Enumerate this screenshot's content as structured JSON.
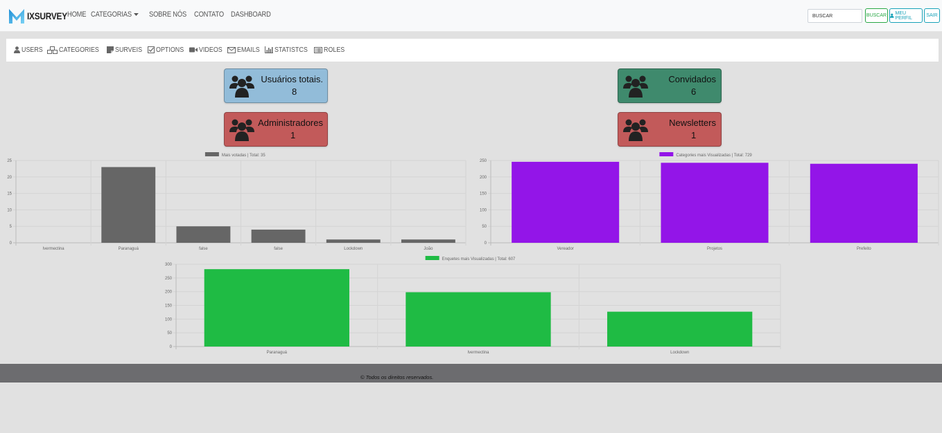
{
  "navbar": {
    "brand": "IXSURVEY",
    "links": [
      {
        "label": "HOME"
      },
      {
        "label": "CATEGORIAS"
      },
      {
        "label": "SOBRE NÓS"
      },
      {
        "label": "CONTATO"
      },
      {
        "label": "DASHBOARD"
      }
    ],
    "search_placeholder": "BUSCAR",
    "search_button": "BUSCAR",
    "profile_button": "MEU PERFIL",
    "logout_button": "SAIR"
  },
  "admin_menu": [
    {
      "label": "USERS",
      "icon": "user-icon"
    },
    {
      "label": "CATEGORIES",
      "icon": "cubes-icon"
    },
    {
      "label": "SURVEIS",
      "icon": "sticky-note-icon"
    },
    {
      "label": "OPTIONS",
      "icon": "check-square-icon"
    },
    {
      "label": "VIDEOS",
      "icon": "video-camera-icon"
    },
    {
      "label": "EMAILS",
      "icon": "envelope-icon"
    },
    {
      "label": "STATISTCS",
      "icon": "bar-chart-icon"
    },
    {
      "label": "ROLES",
      "icon": "list-alt-icon"
    }
  ],
  "cards": {
    "total_users": {
      "title": "Usuários totais.",
      "value": "8",
      "color": "#92bcd9"
    },
    "guests": {
      "title": "Convidados",
      "value": "6",
      "color": "#3f8a6d"
    },
    "admins": {
      "title": "Administradores",
      "value": "1",
      "color": "#c25a5a"
    },
    "newsletters": {
      "title": "Newsletters",
      "value": "1",
      "color": "#c25a5a"
    }
  },
  "chart_data": [
    {
      "type": "bar",
      "legend": "Mais votadas | Total: 35",
      "categories": [
        "Ivermectina",
        "Paranaguá",
        "false",
        "false",
        "Lockdown",
        "João"
      ],
      "values": [
        0,
        23,
        5,
        4,
        1,
        1
      ],
      "ylim": [
        0,
        25
      ],
      "yticks": [
        0,
        5,
        10,
        15,
        20,
        25
      ],
      "color": "#666666",
      "grid": true,
      "legend_position": "top"
    },
    {
      "type": "bar",
      "legend": "Categories mais Visualizadas | Total: 729",
      "categories": [
        "Vereador",
        "Projetos",
        "Prefeito"
      ],
      "values": [
        246,
        243,
        240
      ],
      "ylim": [
        0,
        250
      ],
      "yticks": [
        0,
        50,
        100,
        150,
        200,
        250
      ],
      "color": "#9315e8",
      "grid": true,
      "legend_position": "top"
    },
    {
      "type": "bar",
      "legend": "Enquetes mais Visualizadas | Total: 607",
      "categories": [
        "Paranaguá",
        "Ivermectina",
        "Lockdown"
      ],
      "values": [
        282,
        198,
        127
      ],
      "ylim": [
        0,
        300
      ],
      "yticks": [
        0,
        50,
        100,
        150,
        200,
        250,
        300
      ],
      "color": "#1fbb44",
      "grid": true,
      "legend_position": "top"
    }
  ],
  "footer": {
    "text": "© Todos os direitos reservados."
  }
}
